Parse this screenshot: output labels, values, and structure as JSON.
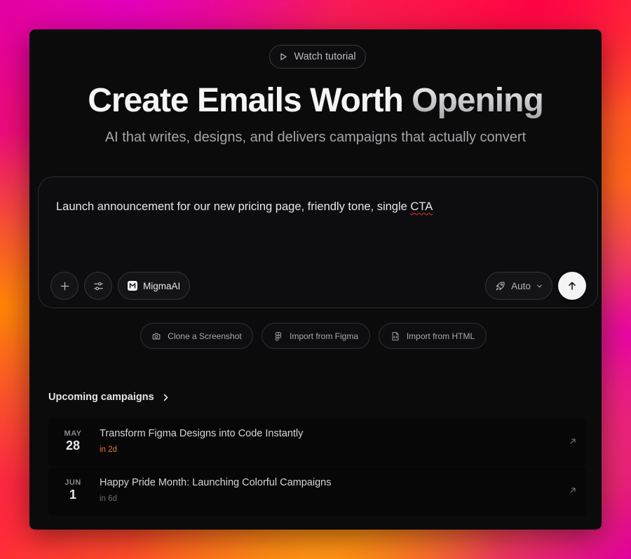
{
  "header": {
    "tutorial_label": "Watch tutorial",
    "title_main": "Create Emails Worth ",
    "title_faded": "Opening",
    "subtitle": "AI that writes, designs, and delivers campaigns that actually convert"
  },
  "prompt": {
    "text_before": "Launch announcement for our new pricing page, friendly tone, single ",
    "text_flagged": "CTA",
    "model_label": "MigmaAI",
    "mode_label": "Auto"
  },
  "actions": [
    {
      "label": "Clone a Screenshot",
      "icon": "camera-icon"
    },
    {
      "label": "Import from Figma",
      "icon": "figma-icon"
    },
    {
      "label": "Import from HTML",
      "icon": "html-file-icon"
    }
  ],
  "campaigns": {
    "heading": "Upcoming campaigns",
    "items": [
      {
        "month": "MAY",
        "day": "28",
        "title": "Transform Figma Designs into Code Instantly",
        "relative": "in 2d",
        "relative_color": "#e8762c"
      },
      {
        "month": "JUN",
        "day": "1",
        "title": "Happy Pride Month: Launching Colorful Campaigns",
        "relative": "in 6d",
        "relative_color": "#6f6f74"
      }
    ]
  },
  "colors": {
    "window_bg": "#0b0b0c",
    "accent_orange": "#e8762c",
    "spellcheck_red": "#e0353a"
  }
}
